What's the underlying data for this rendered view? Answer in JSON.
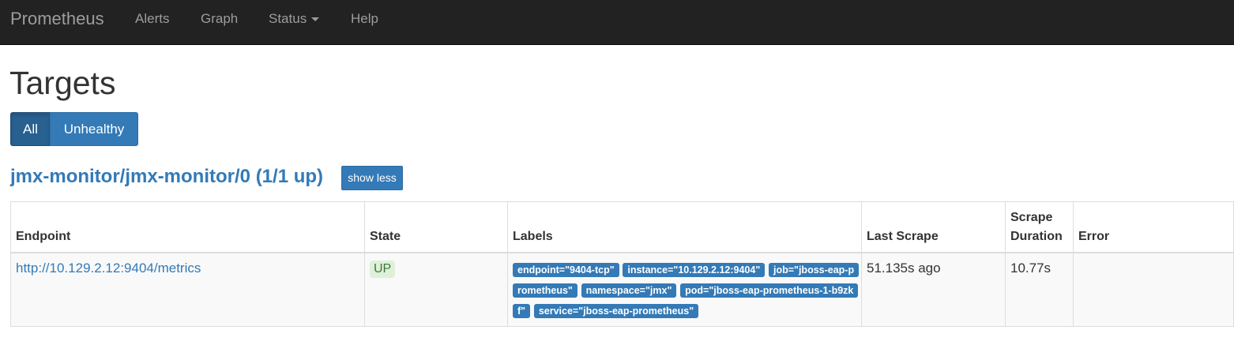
{
  "navbar": {
    "brand": "Prometheus",
    "items": [
      {
        "label": "Alerts"
      },
      {
        "label": "Graph"
      },
      {
        "label": "Status"
      },
      {
        "label": "Help"
      }
    ]
  },
  "page": {
    "title": "Targets",
    "filters": {
      "all": "All",
      "unhealthy": "Unhealthy",
      "selected": "All"
    }
  },
  "job": {
    "heading": "jmx-monitor/jmx-monitor/0 (1/1 up)",
    "toggle_label": "show less"
  },
  "table": {
    "headers": {
      "endpoint": "Endpoint",
      "state": "State",
      "labels": "Labels",
      "last_scrape": "Last Scrape",
      "scrape_duration": "Scrape Duration",
      "error": "Error"
    },
    "rows": [
      {
        "endpoint": "http://10.129.2.12:9404/metrics",
        "state": "UP",
        "labels": [
          "endpoint=\"9404-tcp\"",
          "instance=\"10.129.2.12:9404\"",
          "job=\"jboss-eap-prometheus\"",
          "namespace=\"jmx\"",
          "pod=\"jboss-eap-prometheus-1-b9zkf\"",
          "service=\"jboss-eap-prometheus\""
        ],
        "last_scrape": "51.135s ago",
        "scrape_duration": "10.77s",
        "error": ""
      }
    ]
  },
  "colors": {
    "navbar_bg": "#222222",
    "nav_text": "#9d9d9d",
    "primary": "#337ab7",
    "up_bg": "#dff0d8",
    "up_text": "#3c763d"
  }
}
